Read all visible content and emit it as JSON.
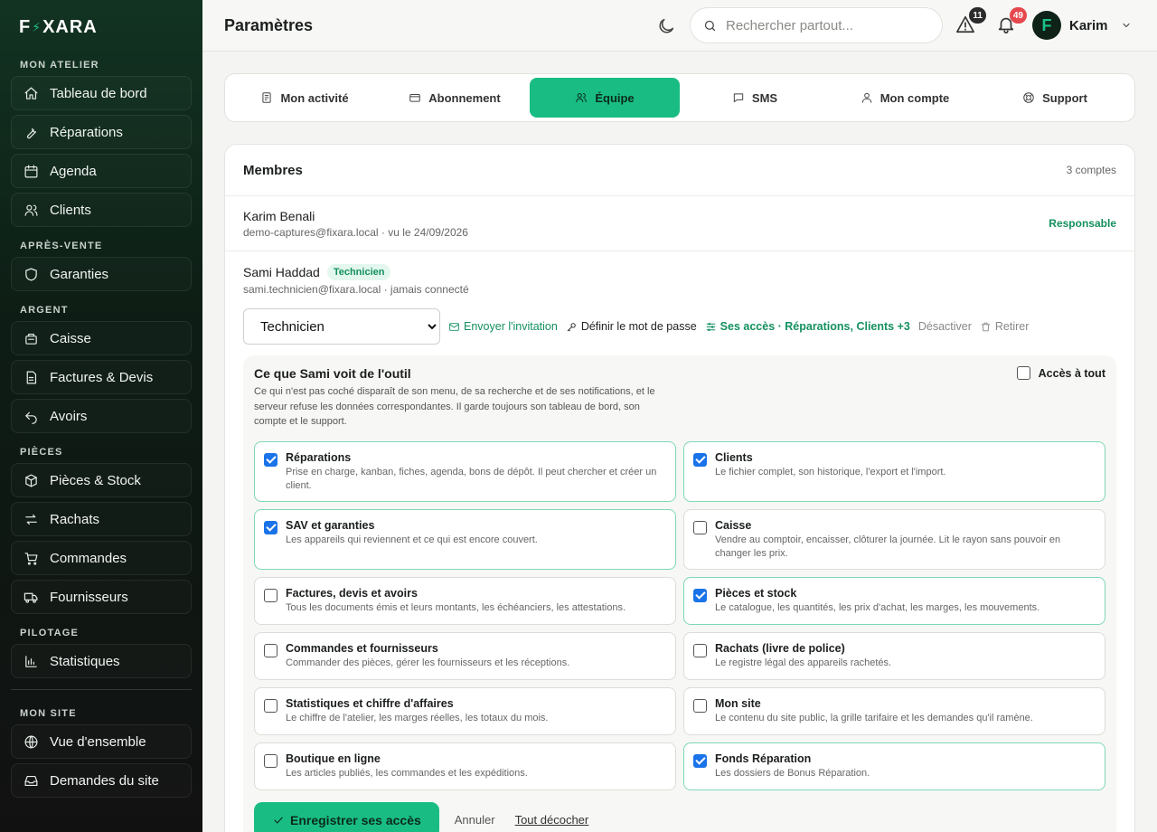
{
  "brand": {
    "logo_prefix": "F",
    "logo_bolt": "⚡",
    "logo_suffix": "XARA"
  },
  "sidebar": {
    "sections": [
      {
        "label": "MON ATELIER",
        "items": [
          {
            "label": "Tableau de bord",
            "icon": "home-icon"
          },
          {
            "label": "Réparations",
            "icon": "wrench-icon"
          },
          {
            "label": "Agenda",
            "icon": "calendar-icon"
          },
          {
            "label": "Clients",
            "icon": "users-icon"
          }
        ]
      },
      {
        "label": "APRÈS-VENTE",
        "items": [
          {
            "label": "Garanties",
            "icon": "shield-icon"
          }
        ]
      },
      {
        "label": "ARGENT",
        "items": [
          {
            "label": "Caisse",
            "icon": "register-icon"
          },
          {
            "label": "Factures & Devis",
            "icon": "document-icon"
          },
          {
            "label": "Avoirs",
            "icon": "undo-icon"
          }
        ]
      },
      {
        "label": "PIÈCES",
        "items": [
          {
            "label": "Pièces & Stock",
            "icon": "box-icon"
          },
          {
            "label": "Rachats",
            "icon": "swap-icon"
          },
          {
            "label": "Commandes",
            "icon": "cart-icon"
          },
          {
            "label": "Fournisseurs",
            "icon": "truck-icon"
          }
        ]
      },
      {
        "label": "PILOTAGE",
        "items": [
          {
            "label": "Statistiques",
            "icon": "chart-icon"
          }
        ]
      },
      {
        "label": "MON SITE",
        "items": [
          {
            "label": "Vue d'ensemble",
            "icon": "globe-icon"
          },
          {
            "label": "Demandes du site",
            "icon": "inbox-icon"
          }
        ]
      }
    ]
  },
  "header": {
    "title": "Paramètres",
    "search_placeholder": "Rechercher partout...",
    "alerts_count": "11",
    "notifications_count": "49",
    "user_initial": "F",
    "user_name": "Karim"
  },
  "tabs": [
    {
      "label": "Mon activité",
      "icon": "activity-icon",
      "active": false
    },
    {
      "label": "Abonnement",
      "icon": "card-icon",
      "active": false
    },
    {
      "label": "Équipe",
      "icon": "team-icon",
      "active": true
    },
    {
      "label": "SMS",
      "icon": "message-icon",
      "active": false
    },
    {
      "label": "Mon compte",
      "icon": "user-icon",
      "active": false
    },
    {
      "label": "Support",
      "icon": "lifebuoy-icon",
      "active": false
    }
  ],
  "members": {
    "title": "Membres",
    "count": "3 comptes",
    "owner": {
      "name": "Karim Benali",
      "sub": "demo-captures@fixara.local · vu le 24/09/2026",
      "role": "Responsable"
    },
    "tech": {
      "name": "Sami Haddad",
      "tag": "Technicien",
      "sub": "sami.technicien@fixara.local · jamais connecté",
      "role_value": "Technicien",
      "actions": {
        "invite": "Envoyer l'invitation",
        "password": "Définir le mot de passe",
        "access": "Ses accès · Réparations, Clients +3",
        "disable": "Désactiver",
        "remove": "Retirer"
      }
    }
  },
  "permissions": {
    "title": "Ce que Sami voit de l'outil",
    "desc": "Ce qui n'est pas coché disparaît de son menu, de sa recherche et de ses notifications, et le serveur refuse les données correspondantes. Il garde toujours son tableau de bord, son compte et le support.",
    "all_label": "Accès à tout",
    "items": [
      {
        "name": "Réparations",
        "text": "Prise en charge, kanban, fiches, agenda, bons de dépôt. Il peut chercher et créer un client.",
        "checked": true
      },
      {
        "name": "Clients",
        "text": "Le fichier complet, son historique, l'export et l'import.",
        "checked": true
      },
      {
        "name": "SAV et garanties",
        "text": "Les appareils qui reviennent et ce qui est encore couvert.",
        "checked": true
      },
      {
        "name": "Caisse",
        "text": "Vendre au comptoir, encaisser, clôturer la journée. Lit le rayon sans pouvoir en changer les prix.",
        "checked": false
      },
      {
        "name": "Factures, devis et avoirs",
        "text": "Tous les documents émis et leurs montants, les échéanciers, les attestations.",
        "checked": false
      },
      {
        "name": "Pièces et stock",
        "text": "Le catalogue, les quantités, les prix d'achat, les marges, les mouvements.",
        "checked": true
      },
      {
        "name": "Commandes et fournisseurs",
        "text": "Commander des pièces, gérer les fournisseurs et les réceptions.",
        "checked": false
      },
      {
        "name": "Rachats (livre de police)",
        "text": "Le registre légal des appareils rachetés.",
        "checked": false
      },
      {
        "name": "Statistiques et chiffre d'affaires",
        "text": "Le chiffre de l'atelier, les marges réelles, les totaux du mois.",
        "checked": false
      },
      {
        "name": "Mon site",
        "text": "Le contenu du site public, la grille tarifaire et les demandes qu'il ramène.",
        "checked": false
      },
      {
        "name": "Boutique en ligne",
        "text": "Les articles publiés, les commandes et les expéditions.",
        "checked": false
      },
      {
        "name": "Fonds Réparation",
        "text": "Les dossiers de Bonus Réparation.",
        "checked": true
      }
    ],
    "save_label": "Enregistrer ses accès",
    "cancel_label": "Annuler",
    "uncheck_label": "Tout décocher"
  },
  "colors": {
    "accent": "#19bd83",
    "accent_text": "#14905f",
    "sidebar_bg": "#0d1c14",
    "badge_dark": "#2b2b2b",
    "badge_red": "#e5484d",
    "checkbox": "#1a73e8"
  }
}
